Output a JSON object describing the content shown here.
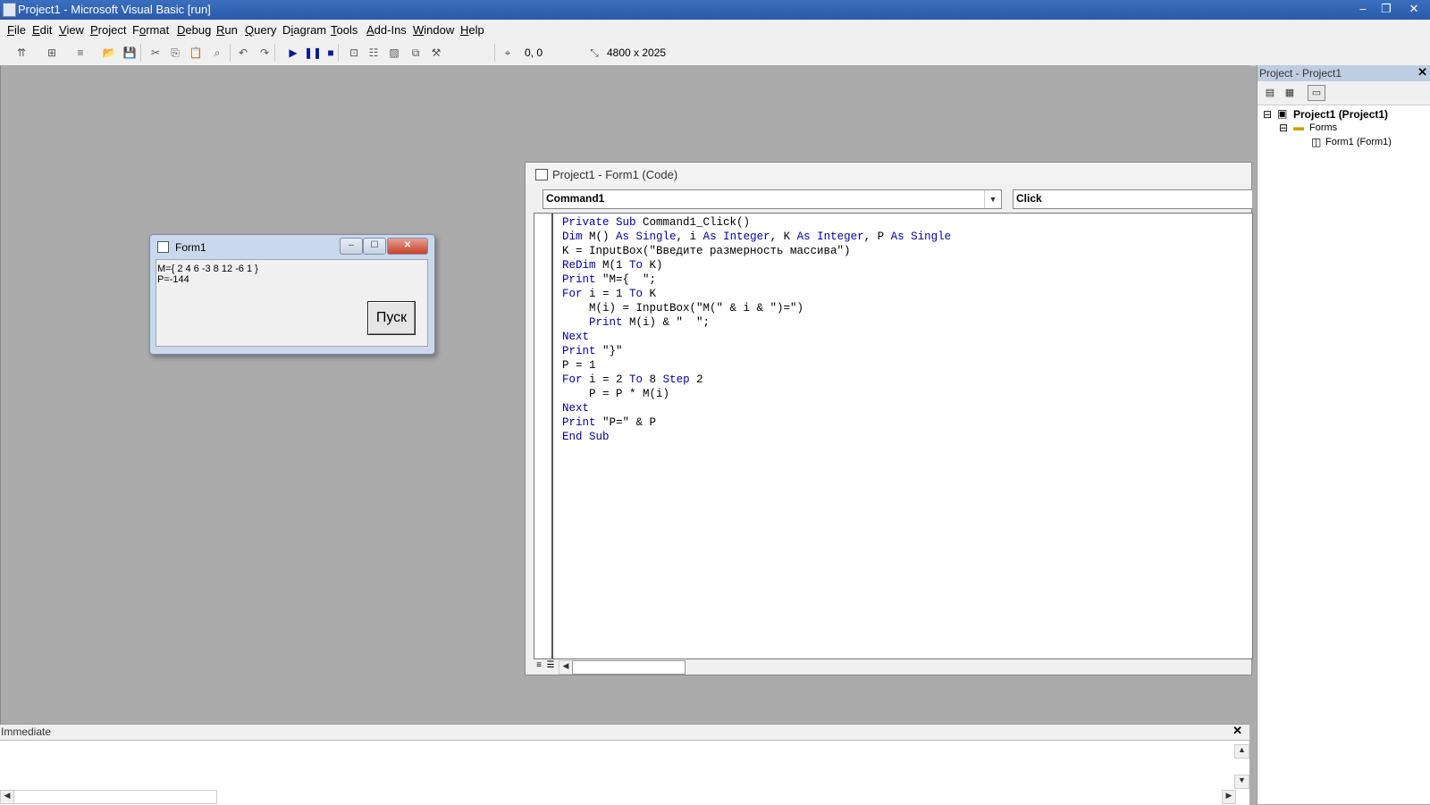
{
  "window": {
    "title": "Project1 - Microsoft Visual Basic [run]",
    "minimize_glyph": "‒",
    "maximize_glyph": "❐",
    "close_glyph": "✕"
  },
  "menu": [
    "File",
    "Edit",
    "View",
    "Project",
    "Format",
    "Debug",
    "Run",
    "Query",
    "Diagram",
    "Tools",
    "Add-Ins",
    "Window",
    "Help"
  ],
  "menu_access_keys": [
    "F",
    "E",
    "V",
    "P",
    "o",
    "D",
    "R",
    "Q",
    "i",
    "T",
    "A",
    "W",
    "H"
  ],
  "toolbar": {
    "position": "0, 0",
    "size": "4800 x 2025",
    "icons": [
      "add-project-icon",
      "add-form-icon",
      "menu-editor-icon",
      "open-icon",
      "save-icon",
      "cut-icon",
      "copy-icon",
      "paste-icon",
      "find-icon",
      "undo-icon",
      "redo-icon",
      "start-icon",
      "break-icon",
      "end-icon",
      "project-explorer-icon",
      "properties-icon",
      "form-layout-icon",
      "object-browser-icon",
      "toolbox-icon"
    ]
  },
  "form1": {
    "title": "Form1",
    "output_lines": [
      "M={ 2 4 6 -3 8 12 -6 1 }",
      "P=-144"
    ],
    "button_label": "Пуск",
    "minimize": "‒",
    "maximize": "☐",
    "close": "✕"
  },
  "code_window": {
    "title": "Project1 - Form1 (Code)",
    "object_combo": "Command1",
    "procedure_combo": "Click",
    "code": [
      [
        {
          "t": "Private Sub ",
          "k": 1
        },
        {
          "t": "Command1_Click()",
          "k": 0
        }
      ],
      [
        {
          "t": "Dim ",
          "k": 1
        },
        {
          "t": "M() ",
          "k": 0
        },
        {
          "t": "As Single",
          "k": 1
        },
        {
          "t": ", i ",
          "k": 0
        },
        {
          "t": "As Integer",
          "k": 1
        },
        {
          "t": ", K ",
          "k": 0
        },
        {
          "t": "As Integer",
          "k": 1
        },
        {
          "t": ", P ",
          "k": 0
        },
        {
          "t": "As Single",
          "k": 1
        }
      ],
      [
        {
          "t": "K = InputBox(\"Введите размерность массива\")",
          "k": 0
        }
      ],
      [
        {
          "t": "ReDim ",
          "k": 1
        },
        {
          "t": "M(1 ",
          "k": 0
        },
        {
          "t": "To ",
          "k": 1
        },
        {
          "t": "K)",
          "k": 0
        }
      ],
      [
        {
          "t": "Print ",
          "k": 1
        },
        {
          "t": "\"M={  \";",
          "k": 0
        }
      ],
      [
        {
          "t": "For ",
          "k": 1
        },
        {
          "t": "i = 1 ",
          "k": 0
        },
        {
          "t": "To ",
          "k": 1
        },
        {
          "t": "K",
          "k": 0
        }
      ],
      [
        {
          "t": "    M(i) = InputBox(\"M(\" & i & \")=\")",
          "k": 0
        }
      ],
      [
        {
          "t": "    Print ",
          "k": 1
        },
        {
          "t": "M(i) & \"  \";",
          "k": 0
        }
      ],
      [
        {
          "t": "Next",
          "k": 1
        }
      ],
      [
        {
          "t": "Print ",
          "k": 1
        },
        {
          "t": "\"}\"",
          "k": 0
        }
      ],
      [
        {
          "t": "P = 1",
          "k": 0
        }
      ],
      [
        {
          "t": "For ",
          "k": 1
        },
        {
          "t": "i = 2 ",
          "k": 0
        },
        {
          "t": "To ",
          "k": 1
        },
        {
          "t": "8 ",
          "k": 0
        },
        {
          "t": "Step ",
          "k": 1
        },
        {
          "t": "2",
          "k": 0
        }
      ],
      [
        {
          "t": "    P = P * M(i)",
          "k": 0
        }
      ],
      [
        {
          "t": "Next",
          "k": 1
        }
      ],
      [
        {
          "t": "Print ",
          "k": 1
        },
        {
          "t": "\"P=\" & P",
          "k": 0
        }
      ],
      [
        {
          "t": "End Sub",
          "k": 1
        }
      ]
    ]
  },
  "project_explorer": {
    "title": "Project - Project1",
    "close": "✕",
    "tree": {
      "project": "Project1 (Project1)",
      "folder": "Forms",
      "item": "Form1 (Form1)"
    }
  },
  "immediate": {
    "title": "Immediate",
    "close": "✕"
  },
  "colors": {
    "keyword": "#0000a0",
    "titlebar": "#2a5aa8",
    "mdi_background": "#ababab"
  }
}
